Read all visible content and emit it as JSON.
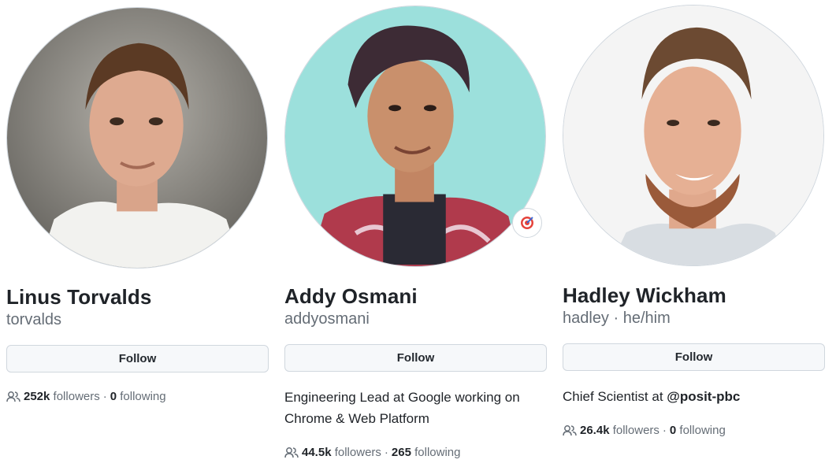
{
  "profiles": [
    {
      "name": "Linus Torvalds",
      "handle": "torvalds",
      "pronouns": "",
      "follow_label": "Follow",
      "bio": "",
      "followers": "252k",
      "followers_label": "followers",
      "following": "0",
      "following_label": "following",
      "avatar_bg": "#8a8a86"
    },
    {
      "name": "Addy Osmani",
      "handle": "addyosmani",
      "pronouns": "",
      "follow_label": "Follow",
      "bio": "Engineering Lead at Google working on Chrome & Web Platform",
      "followers": "44.5k",
      "followers_label": "followers",
      "following": "265",
      "following_label": "following",
      "status_icon": "target-emoji-icon",
      "avatar_bg": "#9ce0dc"
    },
    {
      "name": "Hadley Wickham",
      "handle": "hadley",
      "pronouns": "he/him",
      "follow_label": "Follow",
      "bio_prefix": "Chief Scientist at ",
      "bio_org": "@posit-pbc",
      "followers": "26.4k",
      "followers_label": "followers",
      "following": "0",
      "following_label": "following",
      "avatar_bg": "#f4f4f4"
    }
  ],
  "separator": "·",
  "colors": {
    "text": "#1f2328",
    "muted": "#656d76",
    "border": "#d0d7de",
    "button_bg": "#f6f8fa"
  }
}
